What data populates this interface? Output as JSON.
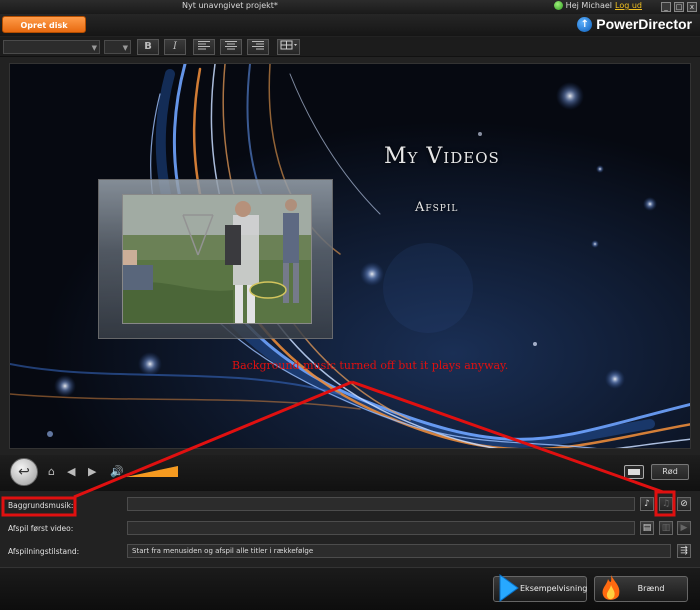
{
  "window": {
    "title": "Nyt unavngivet projekt*",
    "greeting": "Hej Michael",
    "logout": "Log ud",
    "minimize": "_",
    "maximize": "□",
    "close": "x"
  },
  "header": {
    "create_disc": "Opret disk",
    "logo": "PowerDirector"
  },
  "toolbar": {
    "bold": "B",
    "italic": "I"
  },
  "menu_preview": {
    "title": "My Videos",
    "play": "Afspil",
    "annotation": "Background music turned off but it plays anyway."
  },
  "transport": {
    "volume_level_percent": 100,
    "red_button": "Rød"
  },
  "settings": {
    "background_music_label": "Baggrundsmusik:",
    "background_music_value": "",
    "play_first_label": "Afspil først video:",
    "play_first_value": "",
    "playback_mode_label": "Afspilningstilstand:",
    "playback_mode_value": "Start fra menusiden og afspil alle titler i rækkefølge"
  },
  "bottom": {
    "preview": "Eksempelvisning",
    "burn": "Brænd"
  },
  "colors": {
    "accent_orange": "#f07a1e",
    "markup_red": "#e01010",
    "logo_blue": "#1a73d9"
  }
}
